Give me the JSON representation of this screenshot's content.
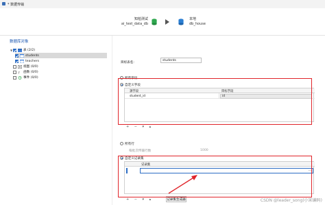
{
  "window": {
    "title": "* 数据传输"
  },
  "flow": {
    "source_name": "知柏测试",
    "source_db": "ai_test_data_db",
    "target_name": "本地",
    "target_db": "db_house"
  },
  "left_panel": {
    "title": "数据库对象",
    "tree": {
      "tables_label": "表 (2/2)",
      "tables": [
        "students",
        "teachers"
      ],
      "views_label": "视图 (0/0)",
      "functions_label": "函数 (0/0)",
      "events_label": "事件 (0/0)"
    }
  },
  "right_panel": {
    "target_table_label": "目标表名:",
    "target_table_value": "students",
    "fields": {
      "all_fields_label": "所有字段",
      "custom_fields_label": "自定义字段",
      "columns": [
        "源字段",
        "目标字段"
      ],
      "rows": [
        {
          "source": "student_id",
          "target": "id"
        }
      ],
      "toolbar": "+ − ▾ ▴"
    },
    "records": {
      "all_rows_label": "所有行",
      "all_rows_hint": "每批次传输行数",
      "batch_value": "1000",
      "custom_records_label": "自定义记录集",
      "column": "记录集",
      "ellipsis": "···",
      "toolbar": "+ − ▾ ▴",
      "generator_button": "记录集生成器"
    }
  },
  "watermark": "CSDN @leader_song(小宋编码)",
  "colors": {
    "accent": "#2b6cc4",
    "highlight": "#e0242a",
    "title_blue": "#1a56b0"
  }
}
